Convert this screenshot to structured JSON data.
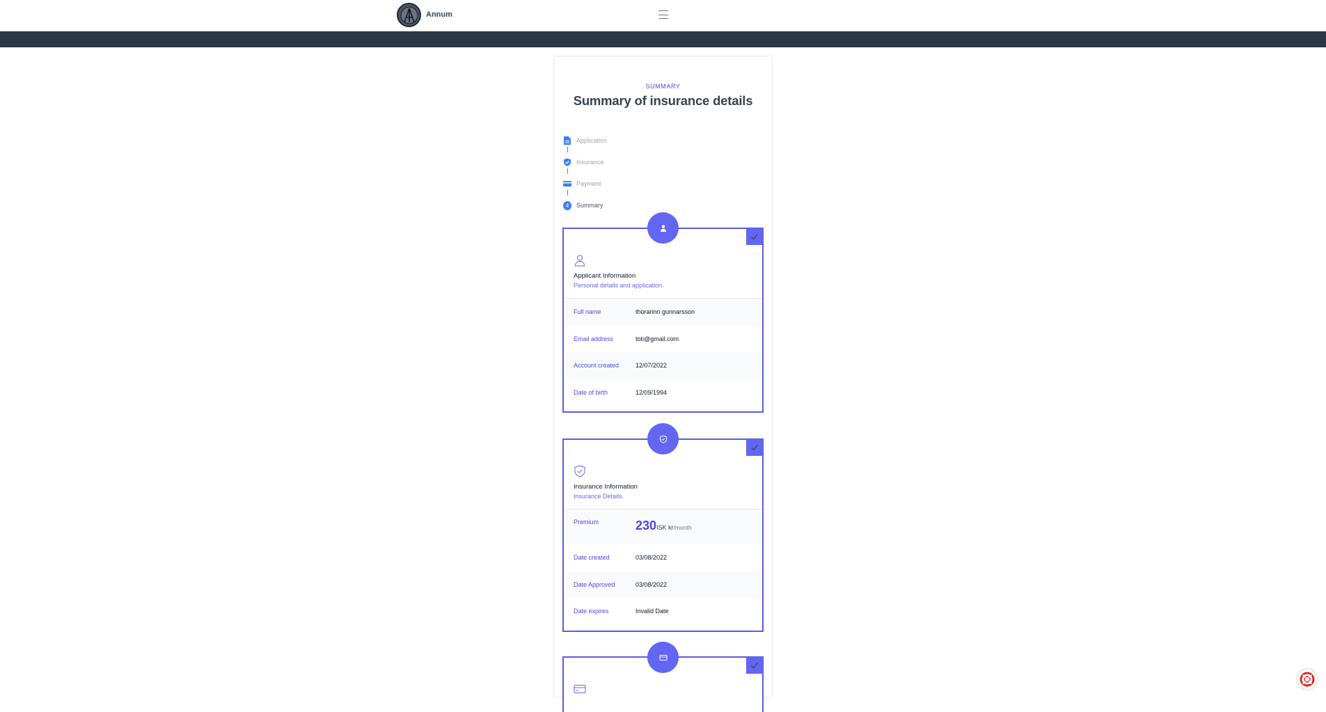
{
  "app": {
    "brand": "Annum"
  },
  "page": {
    "eyebrow": "SUMMARY",
    "title": "Summary of insurance details"
  },
  "steps": [
    {
      "label": "Application",
      "icon": "document-icon"
    },
    {
      "label": "Insurance",
      "icon": "shield-check-icon"
    },
    {
      "label": "Payment",
      "icon": "credit-card-icon"
    },
    {
      "label": "Summary",
      "number": "4",
      "current": true
    }
  ],
  "applicant": {
    "title": "Applicant Information",
    "subtitle": "Personal details and application.",
    "rows": [
      {
        "label": "Full name",
        "value": "thorarinn gunnarsson"
      },
      {
        "label": "Email address",
        "value": "toti@gmail.com"
      },
      {
        "label": "Account created",
        "value": "12/07/2022"
      },
      {
        "label": "Date of birth",
        "value": "12/09/1994"
      }
    ]
  },
  "insurance": {
    "title": "Insurance Information",
    "subtitle": "Insurance Details.",
    "premium_label": "Premium",
    "premium_amount": "230",
    "premium_currency": "ISK kr",
    "premium_period": "/month",
    "rows": [
      {
        "label": "Date created",
        "value": "03/08/2022"
      },
      {
        "label": "Date Approved",
        "value": "03/08/2022"
      },
      {
        "label": "Date expires",
        "value": "Invalid Date"
      }
    ]
  },
  "colors": {
    "accent": "#6366f1",
    "accent_text": "#4f46e5",
    "step_blue": "#3b82f6",
    "header_band": "#2d3748"
  }
}
